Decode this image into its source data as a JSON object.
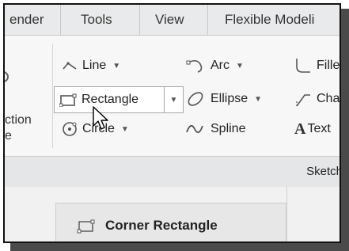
{
  "menu": {
    "tabs": [
      {
        "label": "ender"
      },
      {
        "label": "Tools"
      },
      {
        "label": "View"
      },
      {
        "label": "Flexible Modeli"
      }
    ]
  },
  "ribbon": {
    "left_partial_labels": [
      "ction",
      "e"
    ],
    "tools": {
      "line": "Line",
      "rectangle": "Rectangle",
      "circle": "Circle",
      "arc": "Arc",
      "ellipse": "Ellipse",
      "spline": "Spline",
      "fillet": "Fille",
      "chamfer": "Cha",
      "text": "Text"
    },
    "text_icon_glyph": "A",
    "dropdown_glyph": "▼",
    "group_label": "Sketch"
  },
  "tooltip": {
    "label": "Corner Rectangle"
  },
  "icons": [
    "line-icon",
    "rectangle-icon",
    "circle-icon",
    "arc-icon",
    "ellipse-icon",
    "spline-icon",
    "fillet-icon",
    "chamfer-icon",
    "text-icon",
    "corner-rectangle-icon",
    "mouse-cursor-icon"
  ]
}
